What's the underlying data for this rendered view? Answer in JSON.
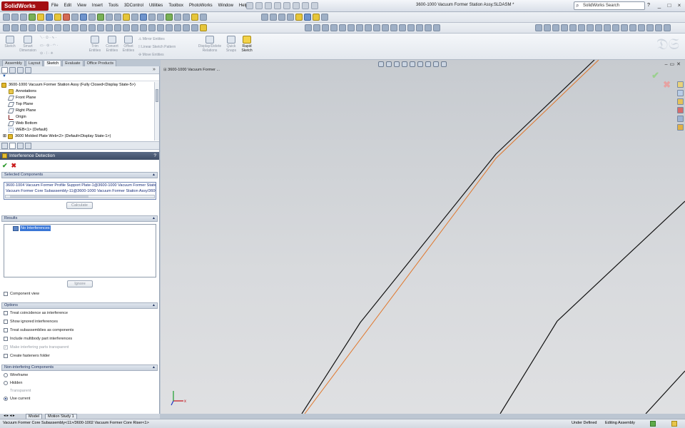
{
  "app": {
    "logo": "SolidWorks",
    "document_title": "3600-1000 Vacuum Former Station Assy.SLDASM *",
    "menu": [
      "File",
      "Edit",
      "View",
      "Insert",
      "Tools",
      "3DControl",
      "Utilities",
      "Toolbox",
      "PhotoWorks",
      "Window",
      "Help"
    ],
    "search_placeholder": "SolidWorks Search",
    "help_label": "?",
    "window_buttons": [
      "_",
      "□",
      "×"
    ]
  },
  "command_manager": {
    "commands": [
      {
        "label": "Sketch",
        "enabled": false
      },
      {
        "label": "Smart\nDimension",
        "enabled": false
      },
      {
        "label": "Trim\nEntities",
        "enabled": false
      },
      {
        "label": "Convert\nEntities",
        "enabled": false
      },
      {
        "label": "Offset\nEntities",
        "enabled": false
      },
      {
        "label": "Display/Delete\nRelations",
        "enabled": false
      },
      {
        "label": "Quick\nSnaps",
        "enabled": false
      },
      {
        "label": "Rapid\nSketch",
        "enabled": true
      }
    ],
    "small_commands": [
      "Mirror Entities",
      "Linear Sketch Pattern",
      "Move Entities"
    ],
    "tabs": [
      {
        "label": "Assembly",
        "active": false
      },
      {
        "label": "Layout",
        "active": false
      },
      {
        "label": "Sketch",
        "active": true
      },
      {
        "label": "Evaluate",
        "active": false
      },
      {
        "label": "Office Products",
        "active": false
      }
    ]
  },
  "feature_tree": {
    "items": [
      {
        "label": "3600-1000 Vacuum Former Station Assy  (Fully Closed<Display State-5>)",
        "icon": "assembly-icon",
        "indent": 0
      },
      {
        "label": "Annotations",
        "icon": "annotations-icon",
        "indent": 1
      },
      {
        "label": "Front Plane",
        "icon": "plane-icon",
        "indent": 1
      },
      {
        "label": "Top Plane",
        "icon": "plane-icon",
        "indent": 1
      },
      {
        "label": "Right Plane",
        "icon": "plane-icon",
        "indent": 1
      },
      {
        "label": "Origin",
        "icon": "origin-icon",
        "indent": 1
      },
      {
        "label": "Web Bottom",
        "icon": "plane-icon",
        "indent": 1
      },
      {
        "label": "WEB<1> (Default)",
        "icon": "sketch-icon",
        "indent": 1
      },
      {
        "label": "3600 Molded Plate Web<2> (Default<Display State-1>)",
        "icon": "assembly-icon",
        "indent": 1
      }
    ]
  },
  "property_manager": {
    "title": "Interference Detection",
    "help": "?",
    "selected_components": {
      "header": "Selected Components",
      "items": [
        "3600-1004 Vacuum Former Profile Support Plate-1@3600-1000 Vacuum Former Station Assy",
        "Vacuum Former Core Subassembly-11@3600-1000 Vacuum Former Station Assy/3600-1002"
      ],
      "calculate_label": "Calculate"
    },
    "results": {
      "header": "Results",
      "items": [
        "No Interferences"
      ],
      "ignore_label": "Ignore",
      "component_view_label": "Component view"
    },
    "options": {
      "header": "Options",
      "items": [
        {
          "label": "Treat coincidence as interference",
          "checked": false,
          "enabled": true
        },
        {
          "label": "Show ignored interferences",
          "checked": false,
          "enabled": true
        },
        {
          "label": "Treat subassemblies as components",
          "checked": false,
          "enabled": true
        },
        {
          "label": "Include multibody part interferences",
          "checked": false,
          "enabled": true
        },
        {
          "label": "Make interfering parts transparent",
          "checked": true,
          "enabled": false
        },
        {
          "label": "Create fasteners folder",
          "checked": false,
          "enabled": true
        }
      ]
    },
    "non_interfering": {
      "header": "Non-interfering Components",
      "items": [
        {
          "label": "Wireframe",
          "selected": false,
          "enabled": true
        },
        {
          "label": "Hidden",
          "selected": false,
          "enabled": true
        },
        {
          "label": "Transparent",
          "selected": false,
          "enabled": false
        },
        {
          "label": "Use current",
          "selected": true,
          "enabled": true
        }
      ]
    }
  },
  "bottom_tabs": [
    "Model",
    "Motion Study 1"
  ],
  "viewport": {
    "document_label": "3600-1000 Vacuum Former ...",
    "edge_color": "#111111",
    "highlight_color": "#e0762a"
  },
  "status_bar": {
    "selection": "Vacuum Former Core Subassembly<11>/3600-1002 Vacuum Former Core Riser<1>",
    "state1": "Under Defined",
    "state2": "Editing Assembly"
  }
}
